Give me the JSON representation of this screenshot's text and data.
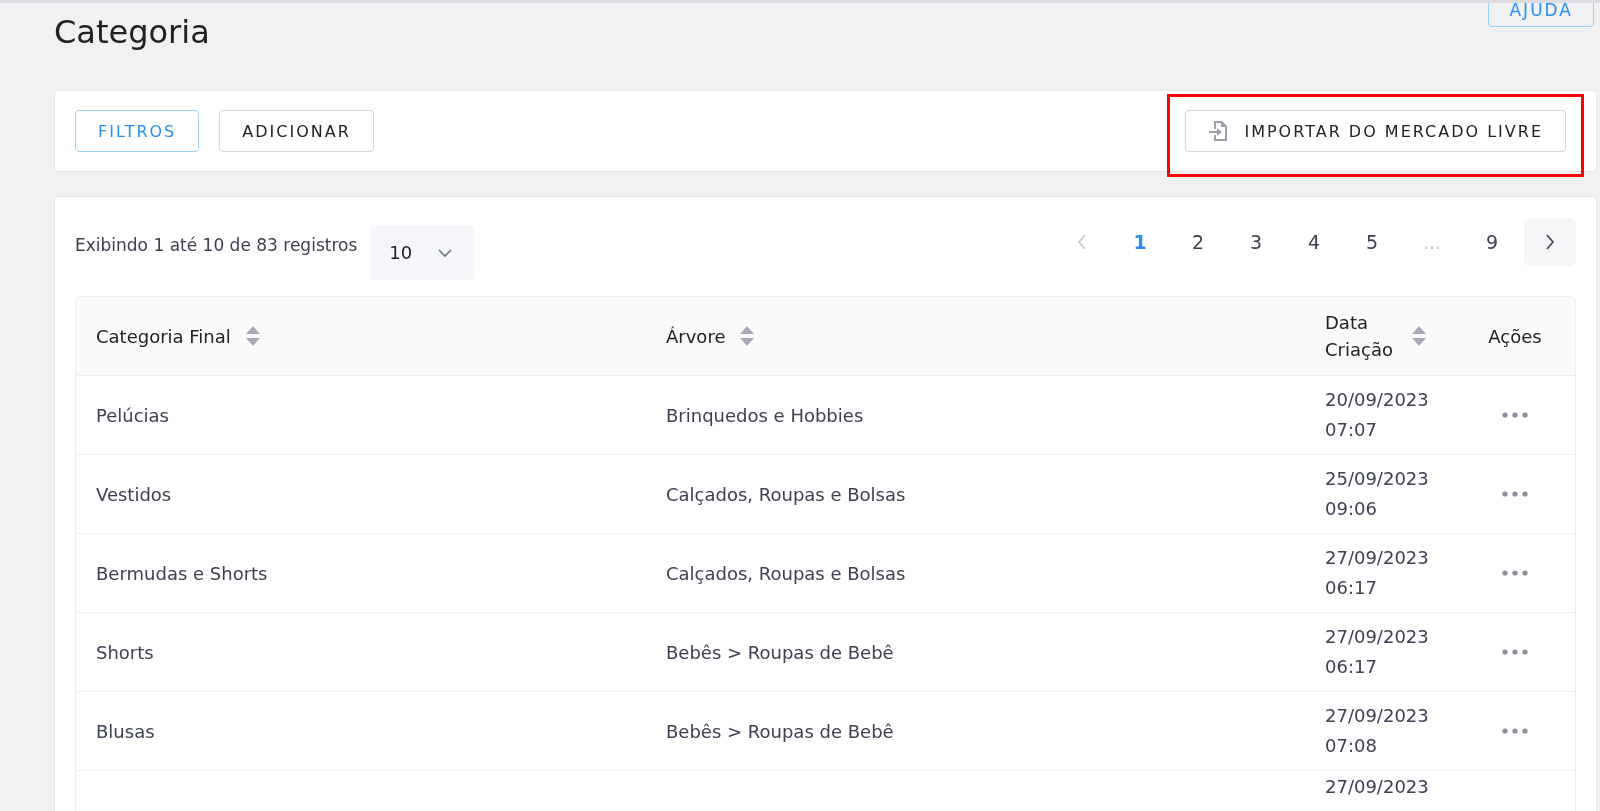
{
  "page": {
    "title": "Categoria"
  },
  "help_button": {
    "label": "AJUDA"
  },
  "toolbar": {
    "buttons": [
      {
        "label": "FILTROS",
        "kind": "primary"
      },
      {
        "label": "ADICIONAR",
        "kind": "default"
      }
    ],
    "import_button": {
      "label": "IMPORTAR DO MERCADO LIVRE",
      "highlighted": true
    }
  },
  "listing": {
    "summary": "Exibindo 1 até 10 de 83 registros",
    "page_size": "10",
    "pagination": {
      "prev_disabled": true,
      "pages": [
        {
          "label": "1",
          "kind": "page",
          "selected": true
        },
        {
          "label": "2",
          "kind": "page",
          "selected": false
        },
        {
          "label": "3",
          "kind": "page",
          "selected": false
        },
        {
          "label": "4",
          "kind": "page",
          "selected": false
        },
        {
          "label": "5",
          "kind": "page",
          "selected": false
        },
        {
          "label": "...",
          "kind": "ellipsis"
        },
        {
          "label": "9",
          "kind": "page",
          "selected": false
        }
      ]
    }
  },
  "table": {
    "columns": [
      {
        "label": "Categoria Final",
        "sortable": true
      },
      {
        "label": "Árvore",
        "sortable": true
      },
      {
        "label": "Data Criação",
        "sortable": true
      },
      {
        "label": "Ações",
        "sortable": false
      }
    ],
    "rows": [
      {
        "categoria_final": "Pelúcias",
        "arvore": "Brinquedos e Hobbies",
        "data_criacao": "20/09/2023",
        "hora": "07:07"
      },
      {
        "categoria_final": "Vestidos",
        "arvore": "Calçados, Roupas e Bolsas",
        "data_criacao": "25/09/2023",
        "hora": "09:06"
      },
      {
        "categoria_final": "Bermudas e Shorts",
        "arvore": "Calçados, Roupas e Bolsas",
        "data_criacao": "27/09/2023",
        "hora": "06:17"
      },
      {
        "categoria_final": "Shorts",
        "arvore": "Bebês > Roupas de Bebê",
        "data_criacao": "27/09/2023",
        "hora": "06:17"
      },
      {
        "categoria_final": "Blusas",
        "arvore": "Bebês > Roupas de Bebê",
        "data_criacao": "27/09/2023",
        "hora": "07:08"
      },
      {
        "data_criacao": "27/09/2023"
      }
    ]
  }
}
